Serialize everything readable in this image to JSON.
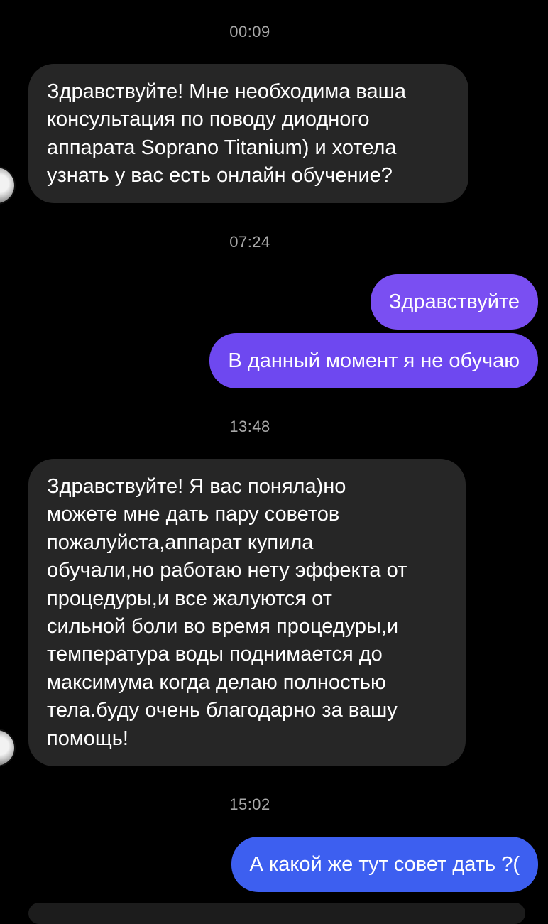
{
  "colors": {
    "background": "#000000",
    "incoming_bubble": "#262626",
    "outgoing_purple": "#6e48f0",
    "outgoing_purple_top": "#7a4ff2",
    "outgoing_blue": "#3d5ff0",
    "timestamp": "#a8a8a8"
  },
  "thread": {
    "timestamps": [
      "00:09",
      "07:24",
      "13:48",
      "15:02"
    ],
    "messages": [
      {
        "side": "incoming",
        "text": "Здравствуйте! Мне необходима ваша\nконсультация по поводу диодного\nаппарата Soprano Titanium) и хотела\nузнать у вас есть онлайн обучение?"
      },
      {
        "side": "outgoing",
        "text": "Здравствуйте"
      },
      {
        "side": "outgoing",
        "text": "В данный момент я не обучаю"
      },
      {
        "side": "incoming",
        "text": "Здравствуйте! Я вас поняла)но\nможете мне дать пару советов\nпожалуйста,аппарат купила\nобучали,но работаю нету эффекта от\nпроцедуры,и все жалуются от\nсильной боли во время процедуры,и\nтемпература воды поднимается до\nмаксимума когда делаю полностью\nтела.буду очень благодарно за вашу\nпомощь!"
      },
      {
        "side": "outgoing",
        "text": "А какой же тут совет дать ?("
      }
    ]
  }
}
